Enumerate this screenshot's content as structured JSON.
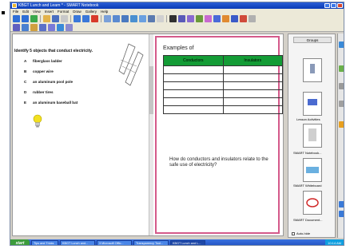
{
  "window": {
    "title": "KBGT Lunch and Learn * - SMART Notebook"
  },
  "menu": [
    "File",
    "Edit",
    "View",
    "Insert",
    "Format",
    "Draw",
    "Gallery",
    "Help"
  ],
  "question": {
    "text": "Identify 5 objects that conduct electricity.",
    "answers": [
      {
        "letter": "A",
        "text": "fiberglass ladder"
      },
      {
        "letter": "B",
        "text": "copper wire"
      },
      {
        "letter": "C",
        "text": "an aluminum pool pole"
      },
      {
        "letter": "D",
        "text": "rubber tires"
      },
      {
        "letter": "E",
        "text": "an aluminum baseball bat"
      }
    ]
  },
  "page": {
    "examples_label": "Examples of",
    "table_headers": [
      "Conductors",
      "Insulators"
    ],
    "table_rows": 6,
    "prompt": "How do conductors and insulators relate to the safe use of electricity?"
  },
  "sorter": {
    "header": "Groups",
    "thumbnails": [
      {
        "label": ""
      },
      {
        "label": "Lesson Activities"
      },
      {
        "label": "SMART Notebook..."
      },
      {
        "label": "SMART Whiteboard"
      },
      {
        "label": ""
      },
      {
        "label": "SMART Document..."
      }
    ],
    "autohide_label": "Auto-hide"
  },
  "taskbar": {
    "start": "start",
    "items": [
      "Tips and Tricks",
      "KBGT Lunch and...",
      "3 Microsoft Offic...",
      "Transparency Tool...",
      "KBGT Lunch and L..."
    ],
    "clock": "10:14 AM"
  },
  "colors": {
    "table_header": "#149c36",
    "page_border": "#d45a8a",
    "titlebar": "#0a3bb5"
  }
}
